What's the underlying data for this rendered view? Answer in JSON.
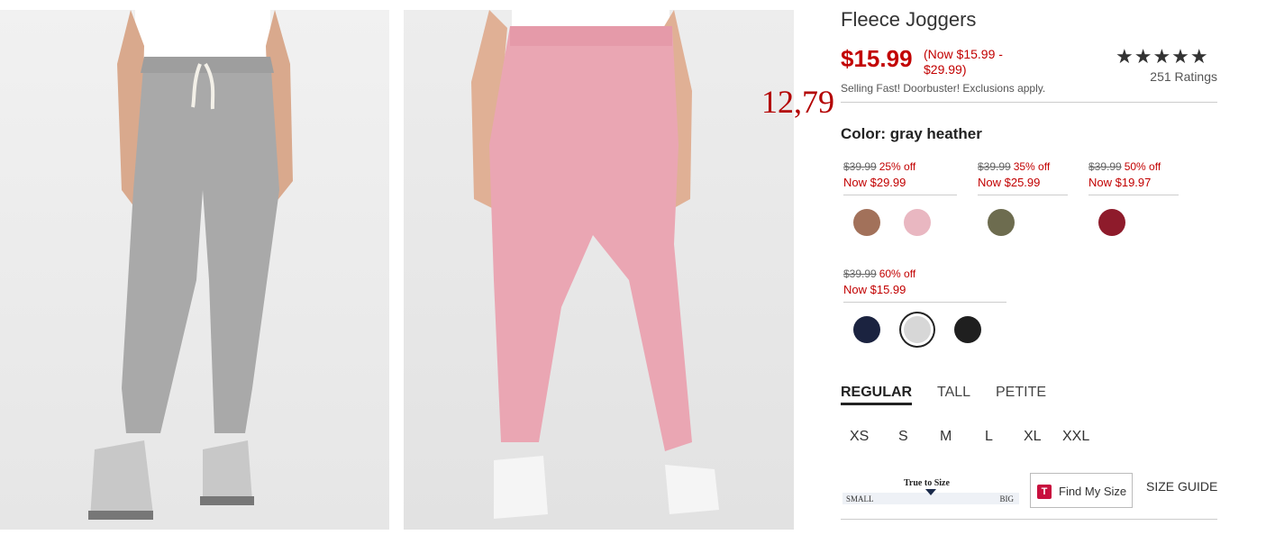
{
  "product": {
    "title": "Fleece Joggers",
    "price": "$15.99",
    "price_range": "(Now $15.99 - $29.99)",
    "selling_note": "Selling Fast! Doorbuster! Exclusions apply.",
    "stars": "★★★★★",
    "ratings_count": "251 Ratings",
    "overlay_number": "12,79"
  },
  "color": {
    "label": "Color: gray heather",
    "groups": [
      {
        "old": "$39.99",
        "off": "25% off",
        "now": "Now $29.99"
      },
      {
        "old": "$39.99",
        "off": "35% off",
        "now": "Now $25.99"
      },
      {
        "old": "$39.99",
        "off": "50% off",
        "now": "Now $19.97"
      },
      {
        "old": "$39.99",
        "off": "60% off",
        "now": "Now $15.99"
      }
    ],
    "swatch_colors": [
      "#a2715a",
      "#e9b7c1",
      "#6d6c4f",
      "#8e1b2b",
      "#1b2340",
      "#d7d7d7",
      "#1f1f1f"
    ],
    "selected_index": 5
  },
  "fit_tabs": [
    "REGULAR",
    "TALL",
    "PETITE"
  ],
  "sizes": [
    "XS",
    "S",
    "M",
    "L",
    "XL",
    "XXL"
  ],
  "fit_scale": {
    "title": "True to Size",
    "small": "SMALL",
    "big": "BIG"
  },
  "find_my_size": {
    "icon_letter": "T",
    "label": "Find My Size"
  },
  "size_guide": "SIZE GUIDE",
  "accent_red": "#c20000"
}
